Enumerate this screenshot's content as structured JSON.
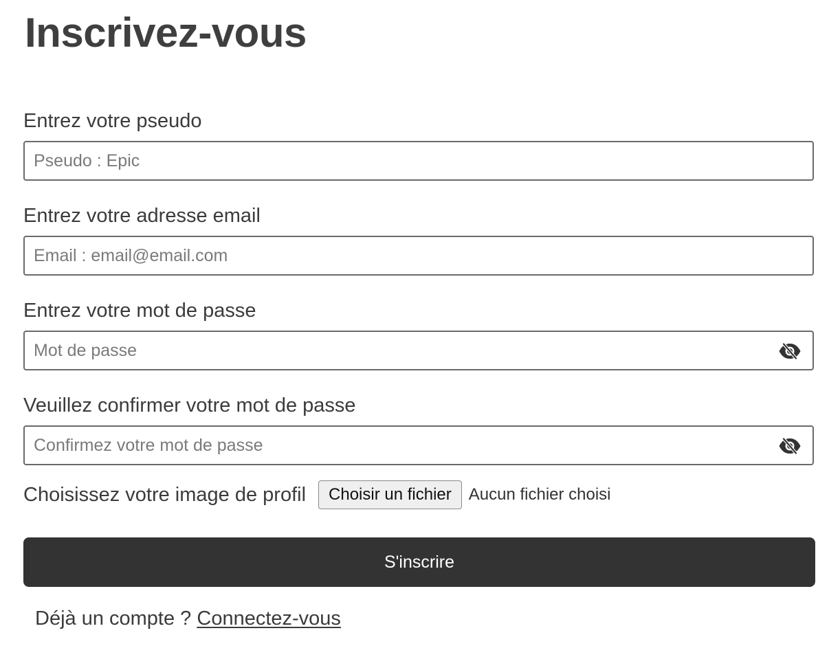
{
  "page": {
    "title": "Inscrivez-vous"
  },
  "form": {
    "pseudo": {
      "label": "Entrez votre pseudo",
      "placeholder": "Pseudo : Epic",
      "value": ""
    },
    "email": {
      "label": "Entrez votre adresse email",
      "placeholder": "Email : email@email.com",
      "value": ""
    },
    "password": {
      "label": "Entrez votre mot de passe",
      "placeholder": "Mot de passe",
      "value": "",
      "toggle_icon": "eye-slash-icon"
    },
    "confirm_password": {
      "label": "Veuillez confirmer votre mot de passe",
      "placeholder": "Confirmez votre mot de passe",
      "value": "",
      "toggle_icon": "eye-slash-icon"
    },
    "profile_image": {
      "label": "Choisissez votre image de profil",
      "button_label": "Choisir un fichier",
      "status": "Aucun fichier choisi"
    },
    "submit_label": "S'inscrire"
  },
  "footer": {
    "prompt": "Déjà un compte ?",
    "link_label": "Connectez-vous"
  },
  "colors": {
    "text": "#3b3b3b",
    "button_bg": "#333333",
    "button_text": "#ffffff",
    "border": "#6a6a6a"
  }
}
